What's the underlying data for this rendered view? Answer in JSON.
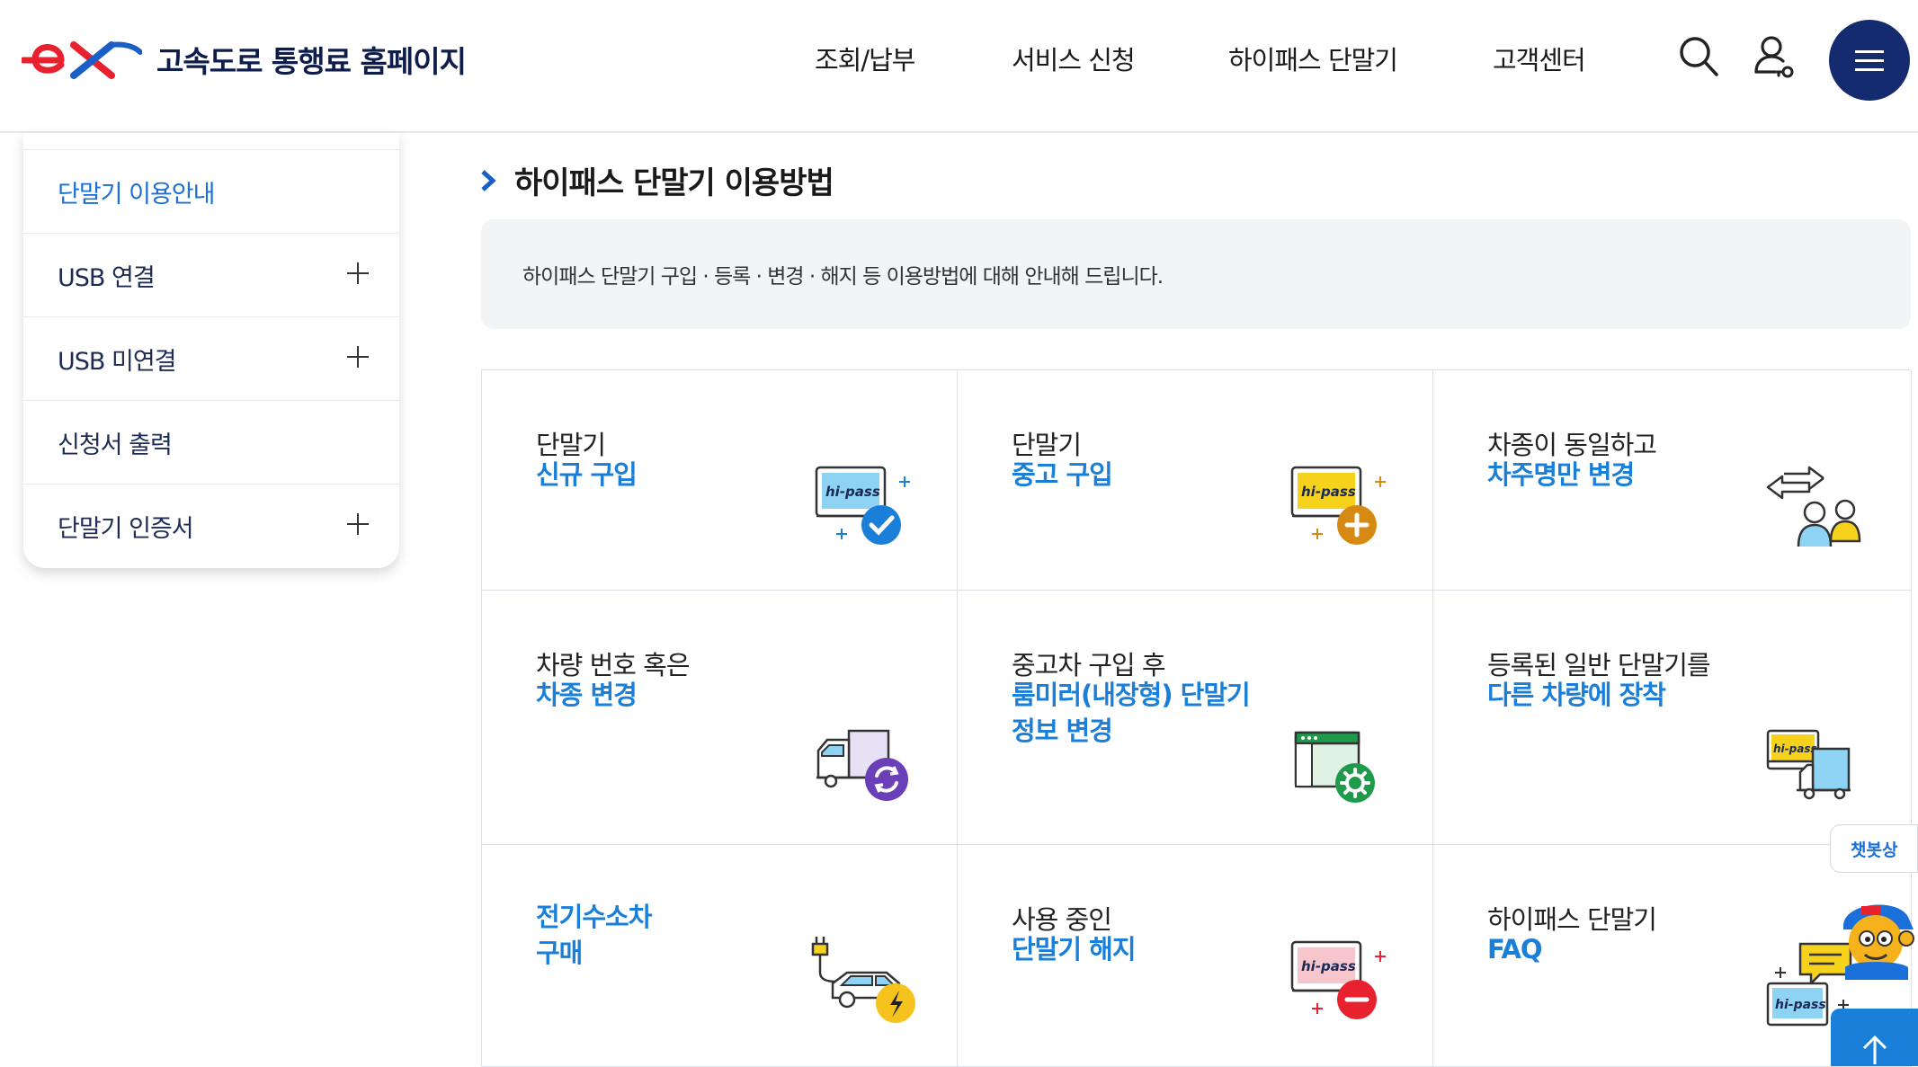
{
  "header": {
    "site_title": "고속도로 통행료 홈페이지",
    "nav": [
      "조회/납부",
      "서비스 신청",
      "하이패스 단말기",
      "고객센터"
    ],
    "icons": [
      "search-icon",
      "user-icon",
      "menu-icon"
    ]
  },
  "sidebar": {
    "items": [
      {
        "label": "단말기 이용안내",
        "active": true,
        "expandable": false
      },
      {
        "label": "USB 연결",
        "active": false,
        "expandable": true
      },
      {
        "label": "USB 미연결",
        "active": false,
        "expandable": true
      },
      {
        "label": "신청서 출력",
        "active": false,
        "expandable": false
      },
      {
        "label": "단말기 인증서",
        "active": false,
        "expandable": true
      }
    ]
  },
  "main": {
    "title": "하이패스 단말기 이용방법",
    "description": "하이패스 단말기 구입 · 등록 · 변경 · 해지 등 이용방법에 대해 안내해 드립니다.",
    "cards": [
      {
        "sub": "단말기",
        "title": [
          "신규 구입"
        ],
        "icon": "hipass-new-icon"
      },
      {
        "sub": "단말기",
        "title": [
          "중고 구입"
        ],
        "icon": "hipass-used-icon"
      },
      {
        "sub": "차종이 동일하고",
        "title": [
          "차주명만 변경"
        ],
        "icon": "owner-change-icon"
      },
      {
        "sub": "차량 번호 혹은",
        "title": [
          "차종 변경"
        ],
        "icon": "vehicle-change-icon"
      },
      {
        "sub": "중고차 구입 후",
        "title": [
          "룸미러(내장형) 단말기",
          "정보 변경"
        ],
        "icon": "roommirror-settings-icon"
      },
      {
        "sub": "등록된 일반 단말기를",
        "title": [
          "다른 차량에 장착"
        ],
        "icon": "hipass-truck-icon"
      },
      {
        "sub": "",
        "title": [
          "전기수소차",
          "구매"
        ],
        "icon": "ev-car-icon"
      },
      {
        "sub": "사용 중인",
        "title": [
          "단말기 해지"
        ],
        "icon": "hipass-cancel-icon"
      },
      {
        "sub": "하이패스 단말기",
        "title": [
          "FAQ"
        ],
        "icon": "faq-chat-icon"
      }
    ]
  },
  "hipass_label": "hi-pass",
  "chatbot_label": "챗봇상",
  "colors": {
    "brand": "#142b70",
    "accent": "#1a7fd8",
    "red": "#e8212e"
  }
}
